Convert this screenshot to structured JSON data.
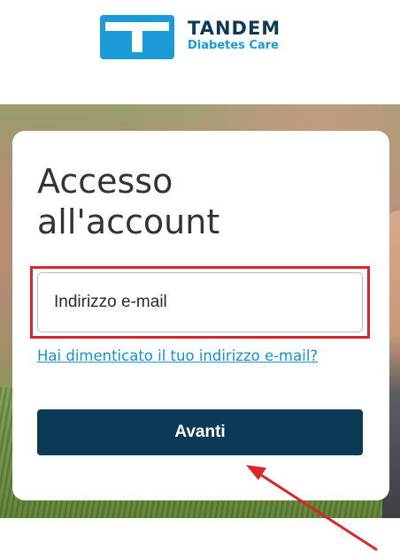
{
  "logo": {
    "brand": "TANDEM",
    "sub": "Diabetes Care"
  },
  "login": {
    "title": "Accesso all'account",
    "email_placeholder": "Indirizzo e-mail",
    "forgot_link": "Hai dimenticato il tuo indirizzo e-mail?",
    "next_button": "Avanti"
  },
  "colors": {
    "brand_blue": "#1a9ad6",
    "brand_navy": "#0c3a56",
    "link": "#1a8fc8",
    "annotation_red": "#d9262a"
  },
  "annotations": {
    "highlight_box": "email-field",
    "arrow_target": "next-button"
  }
}
